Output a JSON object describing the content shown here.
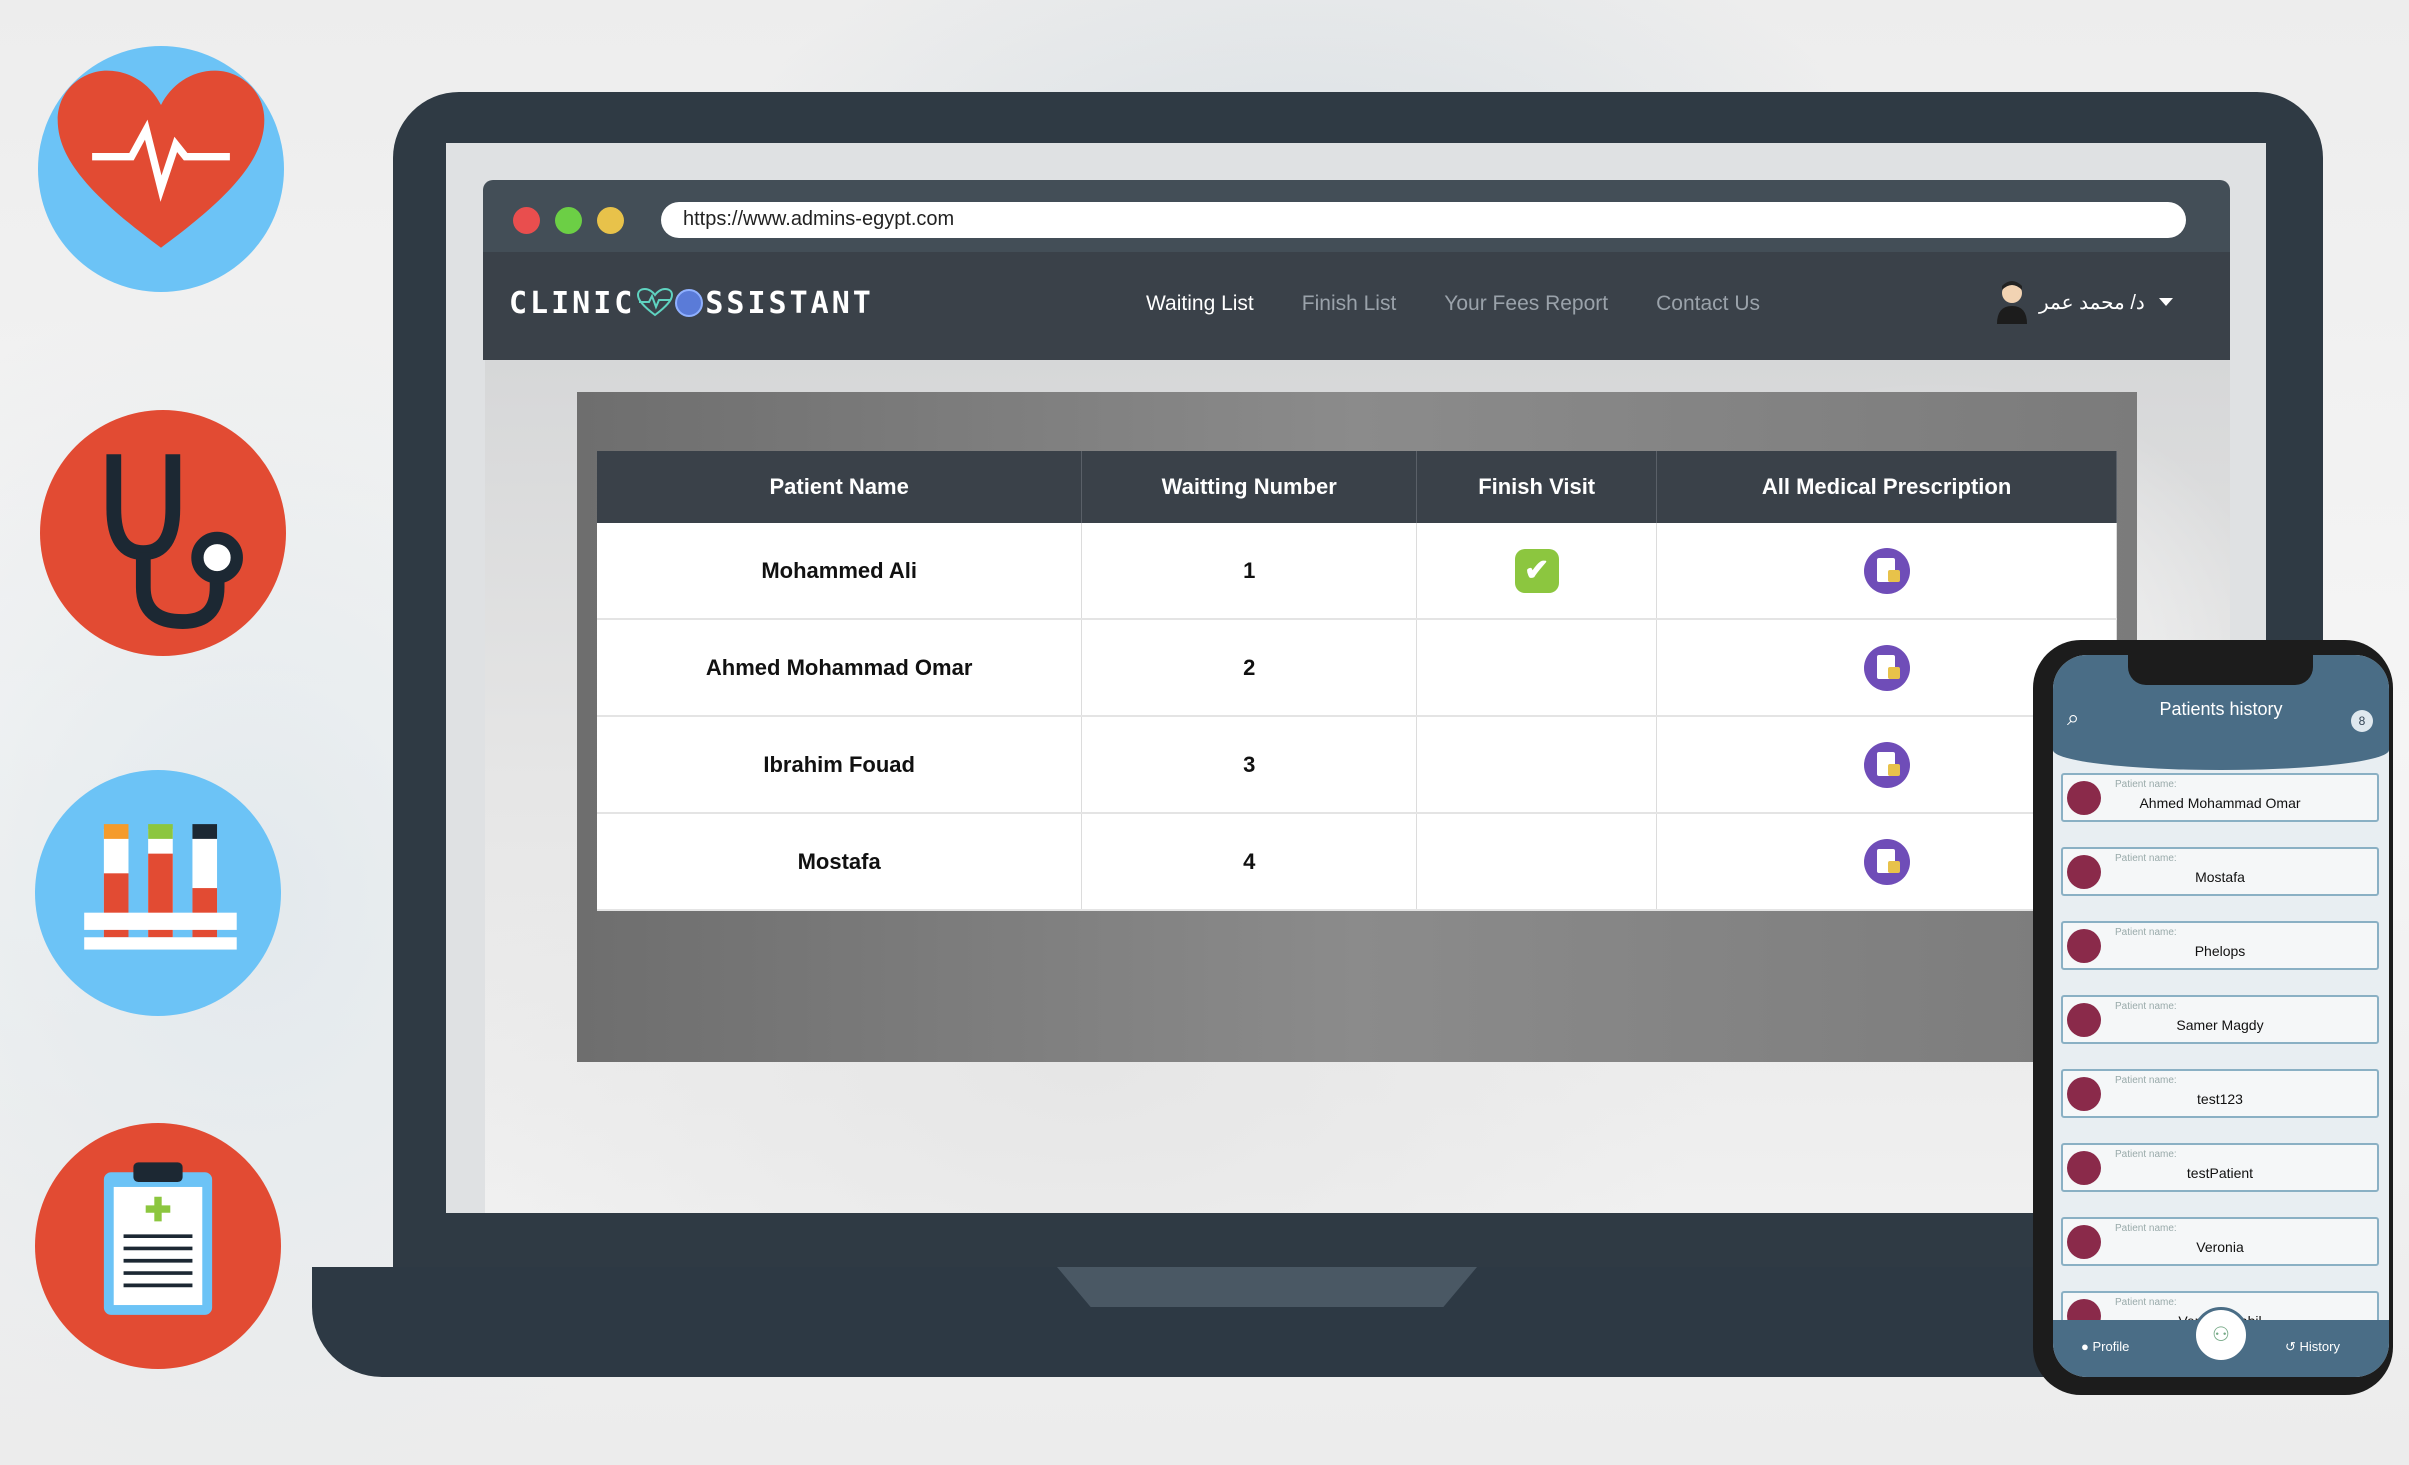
{
  "browser": {
    "url": "https://www.admins-egypt.com"
  },
  "brand": {
    "logo_text_a": "CLINIC",
    "logo_text_b": "SSISTANT"
  },
  "nav": {
    "items": [
      "Waiting List",
      "Finish List",
      "Your Fees Report",
      "Contact Us"
    ],
    "active": "Waiting List",
    "user_name": "د/ محمد عمر"
  },
  "table": {
    "headers": [
      "Patient Name",
      "Waitting Number",
      "Finish Visit",
      "All Medical Prescription"
    ],
    "rows": [
      {
        "name": "Mohammed Ali",
        "number": "1",
        "finished": true
      },
      {
        "name": "Ahmed Mohammad Omar",
        "number": "2",
        "finished": false
      },
      {
        "name": "Ibrahim Fouad",
        "number": "3",
        "finished": false
      },
      {
        "name": "Mostafa",
        "number": "4",
        "finished": false
      }
    ]
  },
  "phone": {
    "title": "Patients history",
    "badge": "8",
    "item_label": "Patient name:",
    "patients": [
      "Ahmed Mohammad Omar",
      "Mostafa",
      "Phelops",
      "Samer Magdy",
      "test123",
      "testPatient",
      "Veronia",
      "Veronia Nabil"
    ],
    "footer": {
      "profile": "Profile",
      "history": "History"
    }
  },
  "icons": [
    "heart-pulse-icon",
    "stethoscope-icon",
    "test-tubes-icon",
    "clipboard-icon"
  ],
  "colors": {
    "nav_bg": "#3a4149",
    "accent_blue": "#6cc3f6",
    "accent_red": "#e24b33",
    "check_green": "#8cc63f",
    "rx_purple": "#6f4db8"
  }
}
